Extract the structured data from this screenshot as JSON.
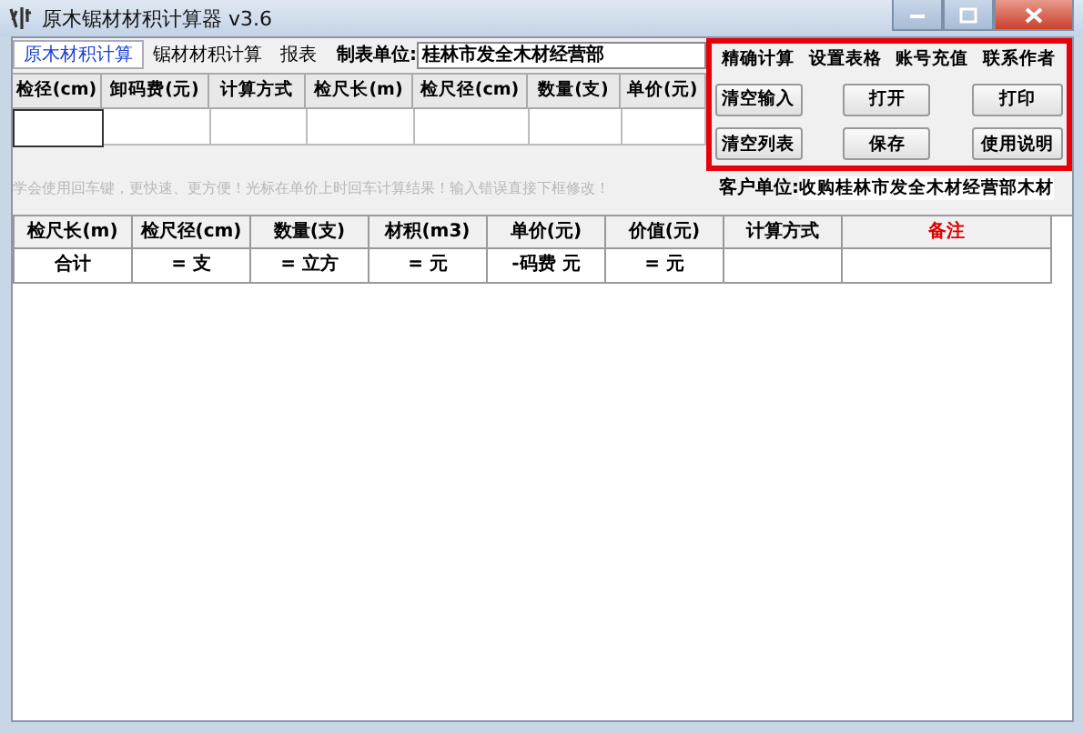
{
  "window": {
    "title": "原木锯材材积计算器 v3.6"
  },
  "tabs": [
    {
      "label": "原木材积计算",
      "selected": true
    },
    {
      "label": "锯材材积计算",
      "selected": false
    },
    {
      "label": "报表",
      "selected": false
    }
  ],
  "maker": {
    "label": "制表单位:",
    "value": "桂林市发全木材经营部"
  },
  "input_table": {
    "columns": [
      "检径(cm)",
      "卸码费(元)",
      "计算方式",
      "检尺长(m)",
      "检尺径(cm)",
      "数量(支)",
      "单价(元)"
    ]
  },
  "panel": {
    "links": [
      "精确计算",
      "设置表格",
      "账号充值",
      "联系作者"
    ],
    "buttons": [
      [
        "清空输入",
        "打开",
        "打印"
      ],
      [
        "清空列表",
        "保存",
        "使用说明"
      ]
    ]
  },
  "hint": "学会使用回车键，更快速、更方便！光标在单价上时回车计算结果！输入错误直接下框修改！",
  "client": {
    "label": "客户单位:",
    "value": "收购桂林市发全木材经营部木材"
  },
  "list_table": {
    "columns": [
      {
        "label": "检尺长(m)",
        "kind": "normal"
      },
      {
        "label": "检尺径(cm)",
        "kind": "normal"
      },
      {
        "label": "数量(支)",
        "kind": "normal"
      },
      {
        "label": "材积(m3)",
        "kind": "normal"
      },
      {
        "label": "单价(元)",
        "kind": "normal"
      },
      {
        "label": "价值(元)",
        "kind": "normal"
      },
      {
        "label": "计算方式",
        "kind": "normal"
      },
      {
        "label": "备注",
        "kind": "alert"
      }
    ],
    "rows": [
      [
        "合计",
        "= 支",
        "= 立方",
        "= 元",
        "-码费 元",
        "= 元",
        "",
        ""
      ]
    ]
  }
}
